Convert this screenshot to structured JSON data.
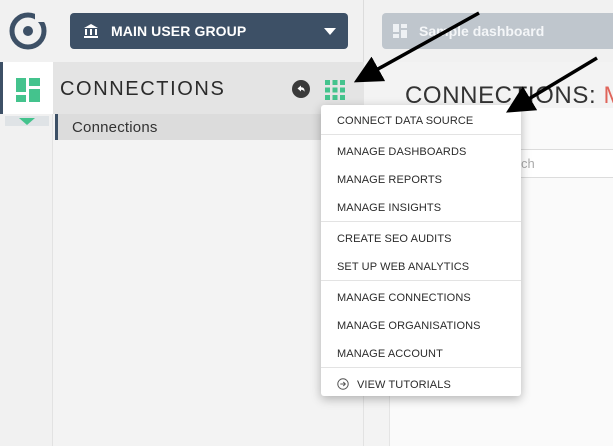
{
  "topbar": {
    "group_label": "MAIN USER GROUP",
    "dashboard_label": "Sample dashboard"
  },
  "sidebar": {
    "section_title": "CONNECTIONS",
    "sub_item": "Connections"
  },
  "main": {
    "title_prefix": "CONNECTIONS: ",
    "title_accent": "M",
    "search_placeholder": "ch"
  },
  "menu": {
    "groups": [
      [
        "CONNECT DATA SOURCE"
      ],
      [
        "MANAGE DASHBOARDS",
        "MANAGE REPORTS",
        "MANAGE INSIGHTS"
      ],
      [
        "CREATE SEO AUDITS",
        "SET UP WEB ANALYTICS"
      ],
      [
        "MANAGE CONNECTIONS",
        "MANAGE ORGANISATIONS",
        "MANAGE ACCOUNT"
      ],
      [
        "VIEW TUTORIALS"
      ]
    ]
  },
  "colors": {
    "navy": "#3d5066",
    "accent_green": "#44c38d",
    "accent_red": "#e0645a"
  }
}
